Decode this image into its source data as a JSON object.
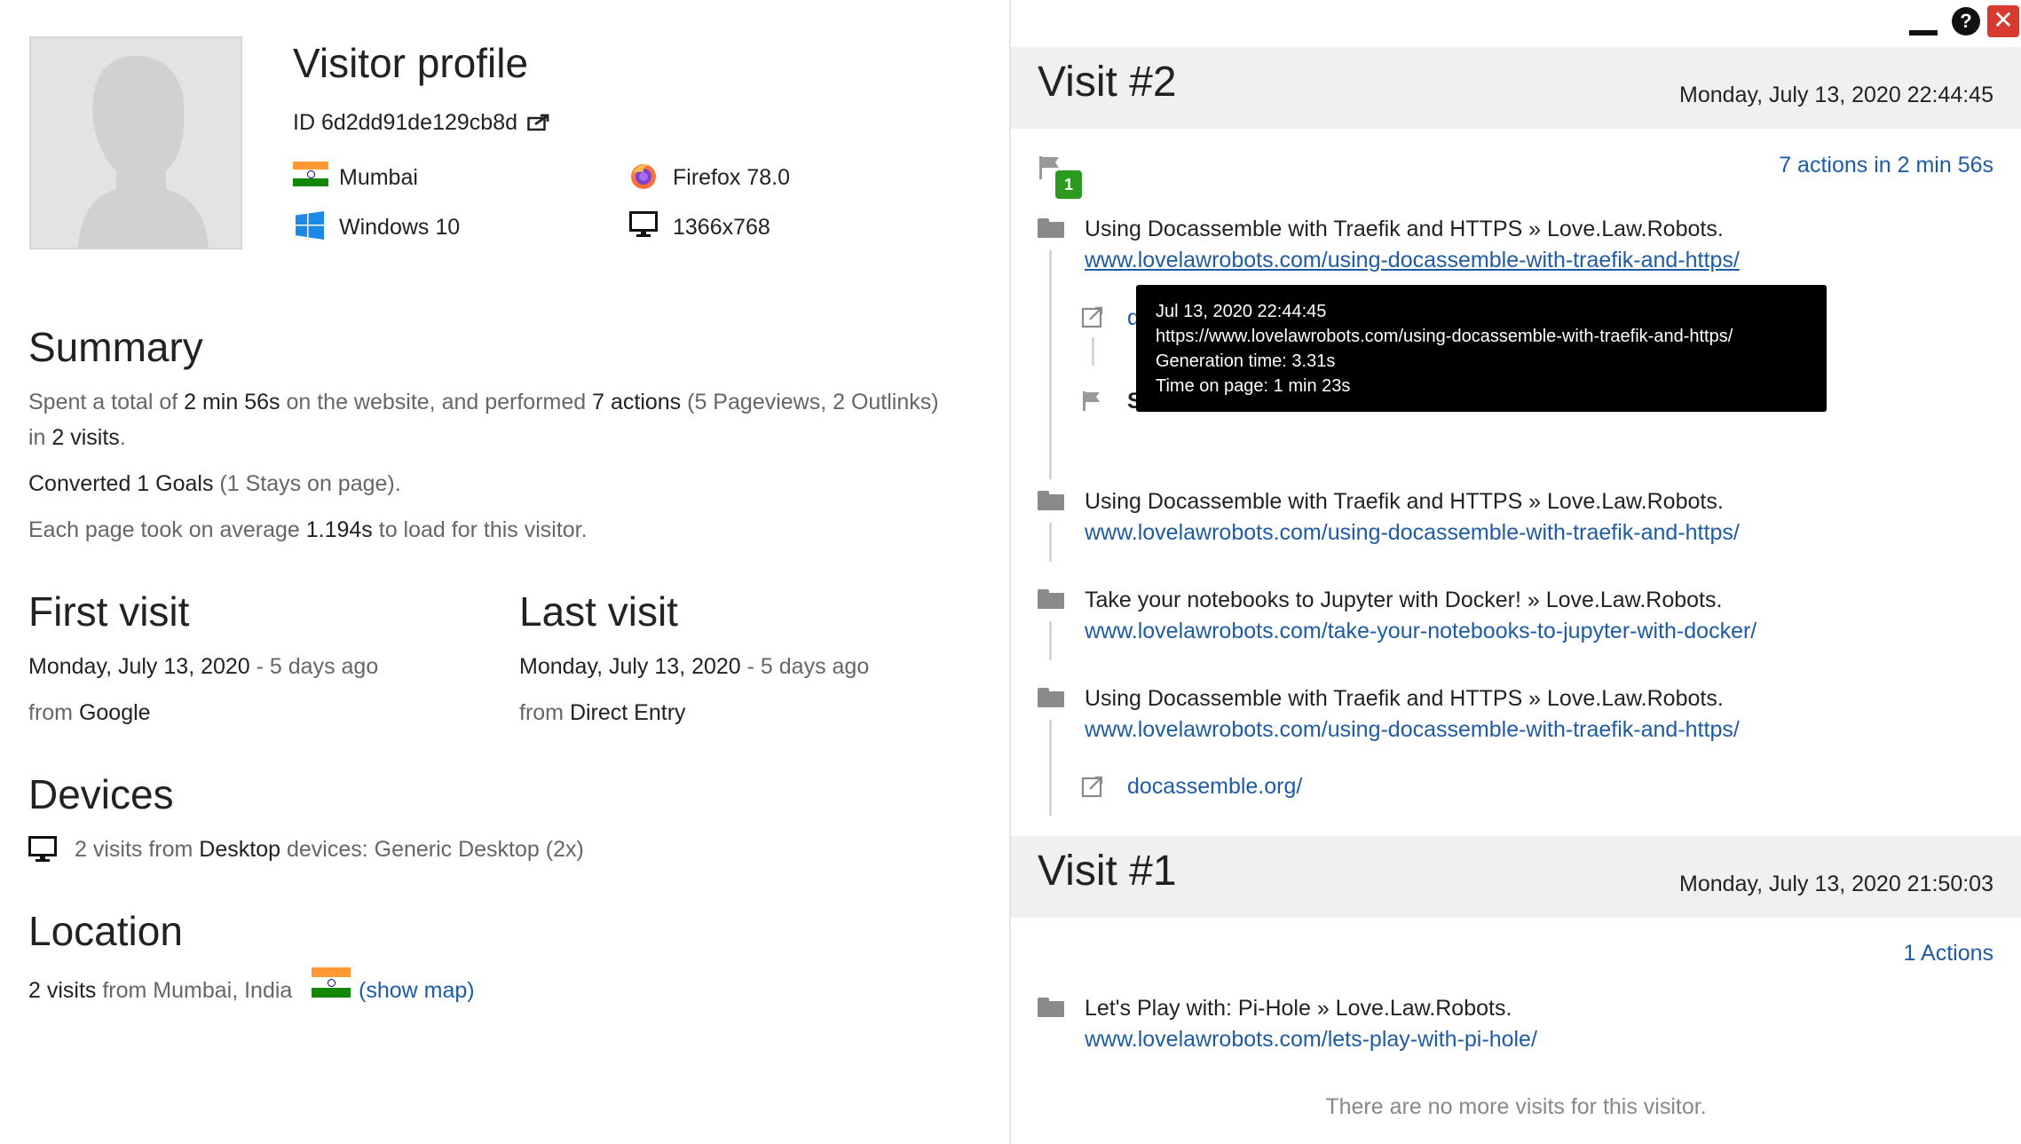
{
  "profile": {
    "title": "Visitor profile",
    "id": "ID 6d2dd91de129cb8d",
    "city": "Mumbai",
    "os": "Windows 10",
    "browser": "Firefox 78.0",
    "resolution": "1366x768"
  },
  "summary": {
    "heading": "Summary",
    "line1_a": "Spent a total of ",
    "line1_b": "2 min 56s",
    "line1_c": " on the website, and performed ",
    "line1_d": "7 actions",
    "line1_e": " (5 Pageviews, 2 Outlinks)",
    "line2_a": "in ",
    "line2_b": "2 visits",
    "line2_c": ".",
    "goals_a": "Converted 1 Goals",
    "goals_b": " (1 Stays on page).",
    "load_a": "Each page took on average ",
    "load_b": "1.194s",
    "load_c": " to load for this visitor."
  },
  "first_visit": {
    "heading": "First visit",
    "date": "Monday, July 13, 2020",
    "ago": " - 5 days ago",
    "from_label": "from ",
    "from_value": "Google"
  },
  "last_visit": {
    "heading": "Last visit",
    "date": "Monday, July 13, 2020",
    "ago": " - 5 days ago",
    "from_label": "from ",
    "from_value": "Direct Entry"
  },
  "devices": {
    "heading": "Devices",
    "a": "2 visits from ",
    "b": "Desktop",
    "c": " devices: Generic Desktop (2x)"
  },
  "location": {
    "heading": "Location",
    "a": "2 visits",
    "b": " from Mumbai, India ",
    "map_link": "(show map)"
  },
  "visit2": {
    "title": "Visit #2",
    "date": "Monday, July 13, 2020 22:44:45",
    "actions": "7 actions in 2 min 56s",
    "goal_badge": "1",
    "items": [
      {
        "title": "Using Docassemble with Traefik and HTTPS » Love.Law.Robots.",
        "url": "www.lovelawrobots.com/using-docassemble-with-traefik-and-https/"
      },
      {
        "title": "Using Docassemble with Traefik and HTTPS » Love.Law.Robots.",
        "url": "www.lovelawrobots.com/using-docassemble-with-traefik-and-https/"
      },
      {
        "title": "Take your notebooks to Jupyter with Docker! » Love.Law.Robots.",
        "url": "www.lovelawrobots.com/take-your-notebooks-to-jupyter-with-docker/"
      },
      {
        "title": "Using Docassemble with Traefik and HTTPS » Love.Law.Robots.",
        "url": "www.lovelawrobots.com/using-docassemble-with-traefik-and-https/"
      }
    ],
    "outlink_partial": "d",
    "goal_partial": "S",
    "outlink": "docassemble.org/"
  },
  "tooltip": {
    "line1": "Jul 13, 2020 22:44:45",
    "line2": "https://www.lovelawrobots.com/using-docassemble-with-traefik-and-https/",
    "line3": "Generation time: 3.31s",
    "line4": "Time on page: 1 min 23s"
  },
  "visit1": {
    "title": "Visit #1",
    "date": "Monday, July 13, 2020 21:50:03",
    "actions": "1 Actions",
    "item_title": "Let's Play with: Pi-Hole » Love.Law.Robots.",
    "item_url": "www.lovelawrobots.com/lets-play-with-pi-hole/"
  },
  "no_more": "There are no more visits for this visitor.",
  "icons": [
    "avatar-silhouette",
    "external-link-icon",
    "india-flag-icon",
    "windows-icon",
    "firefox-icon",
    "monitor-icon",
    "folder-icon",
    "flag-icon",
    "minimize-icon",
    "help-icon",
    "close-icon"
  ],
  "colors": {
    "link": "#1e5ba6",
    "goal_badge": "#2a9b1f",
    "close": "#d93a2f",
    "header_bg": "#f0f0f0",
    "tooltip_bg": "#000000"
  }
}
